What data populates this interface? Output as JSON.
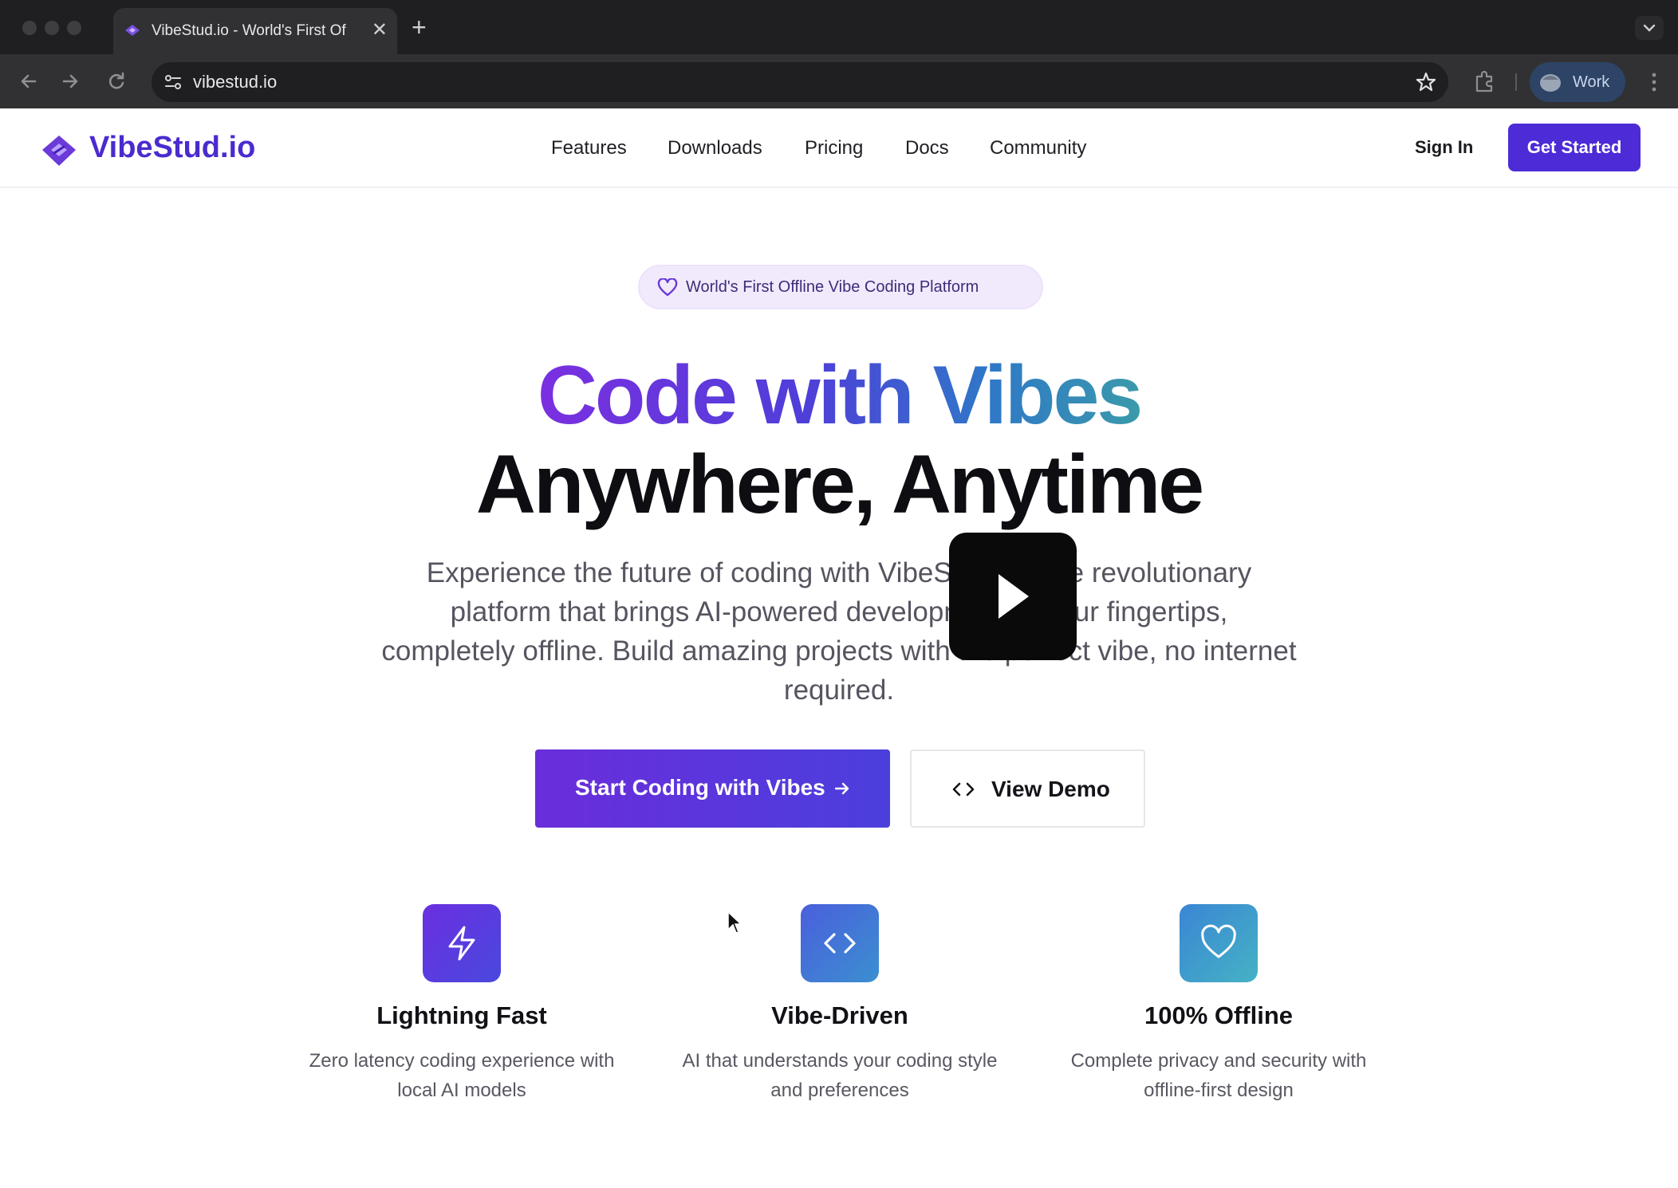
{
  "browser": {
    "tab_title": "VibeStud.io - World's First Of",
    "tab_close": "✕",
    "new_tab": "+",
    "url": "vibestud.io",
    "profile_name": "Work"
  },
  "header": {
    "logo_text": "VibeStud.io",
    "nav": [
      "Features",
      "Downloads",
      "Pricing",
      "Docs",
      "Community"
    ],
    "sign_in": "Sign In",
    "get_started": "Get Started"
  },
  "hero": {
    "badge": "World's First Offline Vibe Coding Platform",
    "title_line1": "Code with Vibes",
    "title_line2": "Anywhere, Anytime",
    "lead_visible": "Experience the future of coding with VibeS… …e revolutionary platform that brings AI-powered develop… …ur fingertips, completely offline. Build amazing projects with the perfect vibe, no internet required.",
    "lead_lines": [
      "Experience the future of coding with VibeStud.io - the revolutionary",
      "platform that brings AI-powered development to your fingertips,",
      "completely offline. Build amazing projects with the perfect vibe, no internet",
      "required."
    ],
    "primary_button": "Start Coding with Vibes",
    "secondary_button": "View Demo"
  },
  "features": [
    {
      "title": "Lightning Fast",
      "desc_line1": "Zero latency coding experience with",
      "desc_line2": "local AI models",
      "icon": "lightning-icon"
    },
    {
      "title": "Vibe-Driven",
      "desc_line1": "AI that understands your coding style",
      "desc_line2": "and preferences",
      "icon": "code-icon"
    },
    {
      "title": "100% Offline",
      "desc_line1": "Complete privacy and security with",
      "desc_line2": "offline-first design",
      "icon": "heart-icon"
    }
  ],
  "colors": {
    "brand": "#4d2bd6",
    "tile_lightning": "#5b3ad8",
    "tile_code": "#3d78d6",
    "tile_heart": "#3ea0c8"
  }
}
